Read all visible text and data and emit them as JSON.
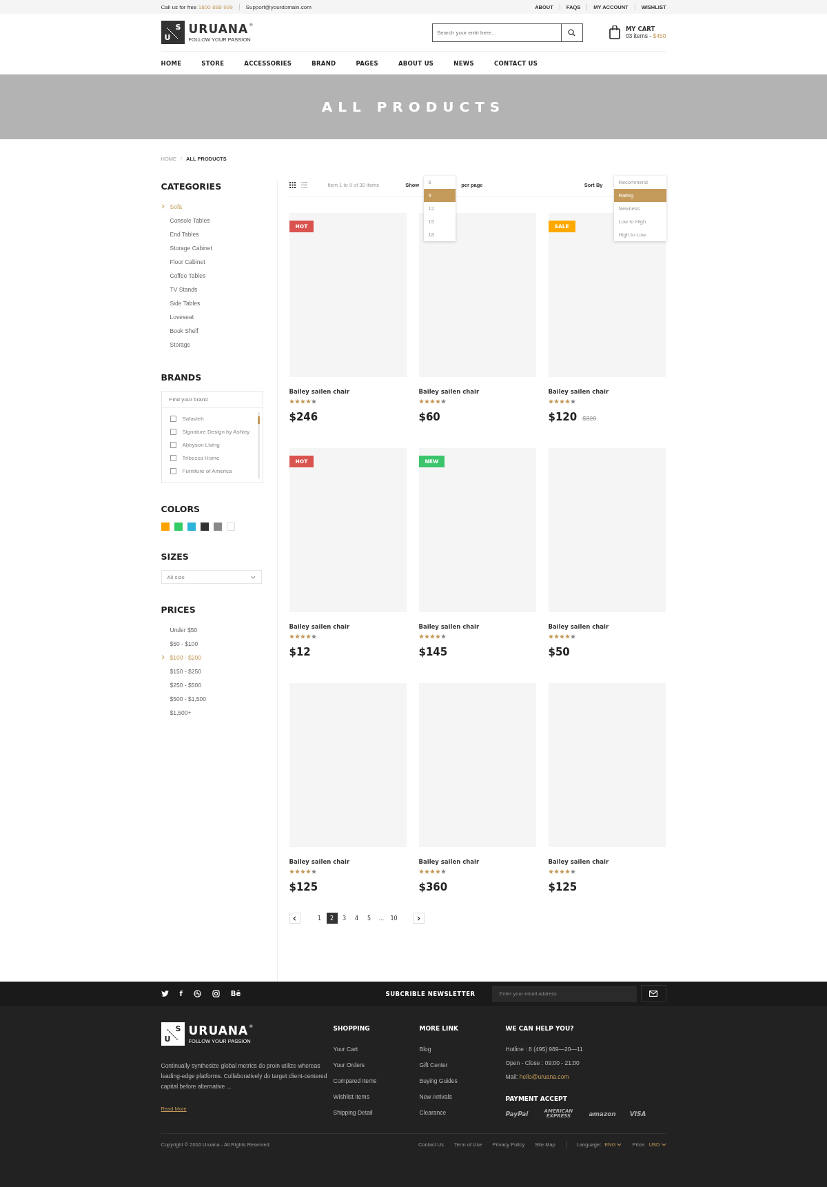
{
  "top_bar": {
    "call_label": "Call us for free",
    "phone": "1800-888-999",
    "email": "Support@yourdomain.com",
    "links": [
      "ABOUT",
      "FAQS",
      "MY ACCOUNT",
      "WISHLIST"
    ]
  },
  "logo": {
    "mark_top": "S",
    "mark_bottom": "U",
    "name": "URUANA",
    "reg": "®",
    "tagline": "FOLLOW YOUR PASSION"
  },
  "search": {
    "placeholder": "Search your entri here..."
  },
  "cart": {
    "title": "MY CART",
    "items": "03 items -",
    "total": "$450"
  },
  "nav": [
    "HOME",
    "STORE",
    "ACCESSORIES",
    "BRAND",
    "PAGES",
    "ABOUT US",
    "NEWS",
    "CONTACT US"
  ],
  "banner": {
    "title": "ALL PRODUCTS"
  },
  "breadcrumb": [
    "HOME",
    "/",
    "ALL PRODUCTS"
  ],
  "sidebar": {
    "categories": {
      "title": "CATEGORIES",
      "items": [
        {
          "label": "Sofa",
          "selected": true
        },
        {
          "label": "Console Tables",
          "selected": false
        },
        {
          "label": "End Tables",
          "selected": false
        },
        {
          "label": "Storage Cabinet",
          "selected": false
        },
        {
          "label": "Floor Cabinet",
          "selected": false
        },
        {
          "label": "Coffee Tables",
          "selected": false
        },
        {
          "label": "TV Stands",
          "selected": false
        },
        {
          "label": "Side Tables",
          "selected": false
        },
        {
          "label": "Loveseat",
          "selected": false
        },
        {
          "label": "Book Shelf",
          "selected": false
        },
        {
          "label": "Storage",
          "selected": false
        }
      ]
    },
    "brands": {
      "title": "BRANDS",
      "placeholder": "Find your brand",
      "items": [
        {
          "label": "Safavieh",
          "checked": false
        },
        {
          "label": "Signature Design by Ashley",
          "checked": false
        },
        {
          "label": "Abbyson Living",
          "checked": false
        },
        {
          "label": "Tribecca Home",
          "checked": false
        },
        {
          "label": "Furniture of America",
          "checked": false
        }
      ]
    },
    "colors": {
      "title": "COLORS",
      "items": [
        {
          "color": "#ffa200"
        },
        {
          "color": "#33cc66"
        },
        {
          "color": "#2bb3d9"
        },
        {
          "color": "#333333"
        },
        {
          "color": "#888888"
        },
        {
          "color": "#ffffff"
        }
      ]
    },
    "sizes": {
      "title": "SIZES",
      "value": "All size"
    },
    "prices": {
      "title": "PRICES",
      "items": [
        {
          "label": "Under $50",
          "selected": false
        },
        {
          "label": "$50 - $100",
          "selected": false
        },
        {
          "label": "$100 - $200",
          "selected": true
        },
        {
          "label": "$150 - $250",
          "selected": false
        },
        {
          "label": "$250 - $500",
          "selected": false
        },
        {
          "label": "$500 - $1,500",
          "selected": false
        },
        {
          "label": "$1,500+",
          "selected": false
        }
      ]
    }
  },
  "toolbar": {
    "count_text": "Item 1 to 9 of 30 Items",
    "show_label": "Show",
    "per_page_label": "per page",
    "sort_label": "Sort By",
    "show_options": [
      {
        "label": "6",
        "selected": false
      },
      {
        "label": "9",
        "selected": true
      },
      {
        "label": "12",
        "selected": false
      },
      {
        "label": "15",
        "selected": false
      },
      {
        "label": "18",
        "selected": false
      }
    ],
    "sort_options": [
      {
        "label": "Recommend",
        "selected": false
      },
      {
        "label": "Rating",
        "selected": true
      },
      {
        "label": "Newness",
        "selected": false
      },
      {
        "label": "Low to High",
        "selected": false
      },
      {
        "label": "High to Low",
        "selected": false
      }
    ]
  },
  "products": [
    {
      "name": "Bailey sailen chair",
      "stars": 4,
      "price": "$246",
      "badge": {
        "label": "HOT",
        "color": "#d9534f"
      }
    },
    {
      "name": "Bailey sailen chair",
      "stars": 4,
      "price": "$60"
    },
    {
      "name": "Bailey sailen chair",
      "stars": 4,
      "price": "$120",
      "old_price": "$320",
      "badge": {
        "label": "SALE",
        "color": "#ffa800"
      }
    },
    {
      "name": "Bailey sailen chair",
      "stars": 4,
      "price": "$12",
      "badge": {
        "label": "HOT",
        "color": "#d9534f"
      }
    },
    {
      "name": "Bailey sailen chair",
      "stars": 4,
      "price": "$145",
      "badge": {
        "label": "NEW",
        "color": "#3cc46c"
      }
    },
    {
      "name": "Bailey sailen chair",
      "stars": 4,
      "price": "$50"
    },
    {
      "name": "Bailey sailen chair",
      "stars": 4,
      "price": "$125"
    },
    {
      "name": "Bailey sailen chair",
      "stars": 4,
      "price": "$360"
    },
    {
      "name": "Bailey sailen chair",
      "stars": 4,
      "price": "$125"
    }
  ],
  "pagination": [
    {
      "label": "1",
      "selected": false
    },
    {
      "label": "2",
      "selected": true
    },
    {
      "label": "3",
      "selected": false
    },
    {
      "label": "4",
      "selected": false
    },
    {
      "label": "5",
      "selected": false
    },
    {
      "label": "...",
      "selected": false
    },
    {
      "label": "10",
      "selected": false
    }
  ],
  "newsletter": {
    "social": [
      {
        "kind": "twitter"
      },
      {
        "kind": "text",
        "label": "f"
      },
      {
        "kind": "dribbble"
      },
      {
        "kind": "instagram"
      },
      {
        "kind": "text",
        "label": "Bē"
      }
    ],
    "title": "SUBCRIBLE NEWSLETTER",
    "placeholder": "Enter your email address"
  },
  "footer": {
    "logo": {
      "mark_top": "S",
      "mark_bottom": "U",
      "name": "URUANA",
      "reg": "®",
      "tagline": "FOLLOW YOUR PASSION"
    },
    "about": "Continually synthesize global metrics do proin utilize whereas leading-edge platforms. Collaboratively do target client-centered capital before alternative ...",
    "read_more": "Read More",
    "columns": [
      {
        "title": "SHOPPING",
        "links": [
          "Your Cart",
          "Your Orders",
          "Compared Items",
          "Wishlist Items",
          "Shipping Detail"
        ]
      },
      {
        "title": "MORE LINK",
        "links": [
          "Blog",
          "Gift Center",
          "Buying Guides",
          "New Arrivals",
          "Clearance"
        ]
      }
    ],
    "help": {
      "title": "WE CAN HELP YOU?",
      "hotline": "Hotline : 8 (495) 989—20—11",
      "hours": "Open - Close : 09:00 - 21:00",
      "mail_label": "Mail:",
      "mail": "hello@uruana.com"
    },
    "payment": {
      "title": "PAYMENT ACCEPT",
      "methods": [
        "PayPal",
        "AMERICAN EXPRESS",
        "amazon",
        "VISA"
      ]
    },
    "copyright": "Copyright © 2016 Uruana - All Rights Reserved.",
    "bottom_links": [
      "Contact Us",
      "Term of Use",
      "Privacy Policy",
      "Site Map"
    ],
    "language_label": "Language:",
    "language": "ENG",
    "price_label": "Price:",
    "currency": "USD"
  }
}
